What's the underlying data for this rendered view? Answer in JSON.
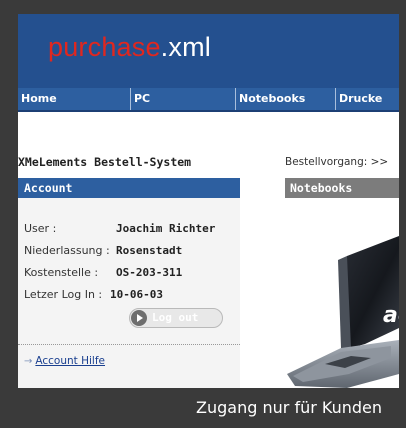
{
  "header": {
    "logo_red": "purchase",
    "logo_white": ".xml"
  },
  "nav": {
    "items": [
      {
        "label": "Home"
      },
      {
        "label": "PC"
      },
      {
        "label": "Notebooks"
      },
      {
        "label": "Drucke"
      }
    ]
  },
  "app_title": "XMeLements Bestell-System",
  "bestellvorgang": "Bestellvorgang:  >>",
  "account": {
    "heading": "Account",
    "fields": [
      {
        "label": "User :",
        "value": "Joachim Richter"
      },
      {
        "label": "Niederlassung :",
        "value": "Rosenstadt"
      },
      {
        "label": "Kostenstelle :",
        "value": "OS-203-311"
      },
      {
        "label": "Letzer Log In :",
        "value": "10-06-03"
      }
    ],
    "logout_label": "Log out",
    "help_link": "Account Hilfe",
    "help_arrow": "→"
  },
  "notebooks": {
    "heading": "Notebooks",
    "brand_mark": "ac"
  },
  "caption": "Zugang nur für Kunden"
}
